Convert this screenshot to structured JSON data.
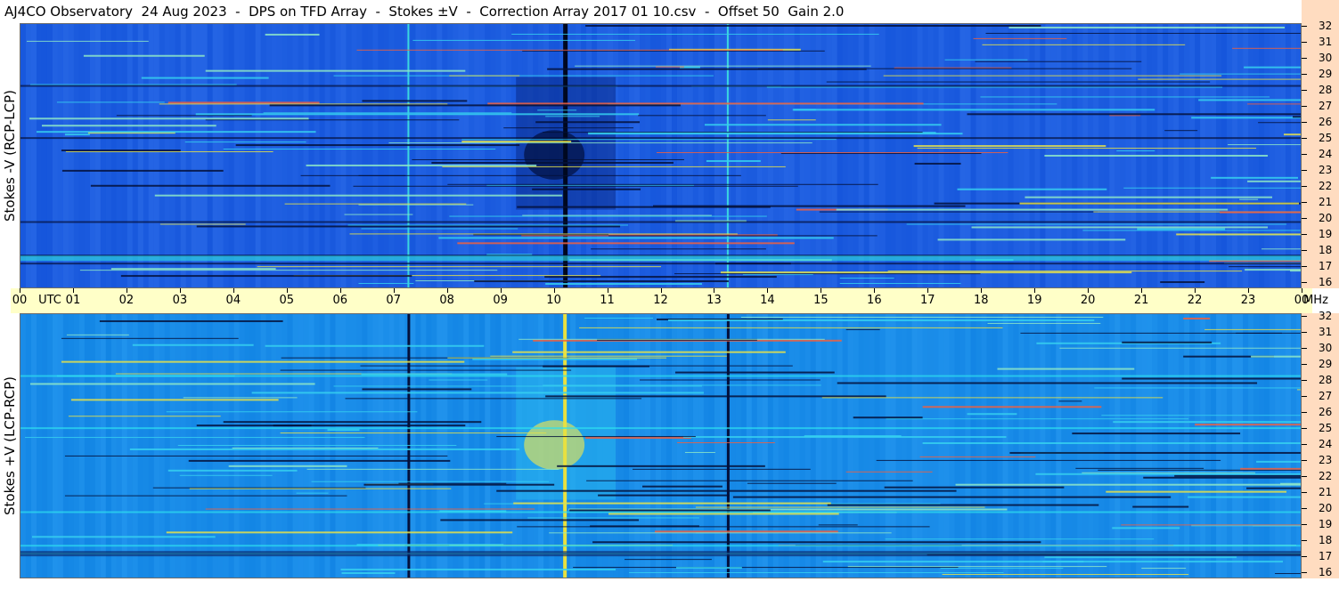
{
  "title": "AJ4CO Observatory  24 Aug 2023  -  DPS on TFD Array  -  Stokes ±V  -  Correction Array 2017 01 10.csv  -  Offset 50  Gain 2.0",
  "colors": {
    "background_top": "#1e5ee0",
    "background_bottom": "#1a8ce8",
    "time_axis_bg": "#ffffc8",
    "freq_axis_bg": "#ffdcc0",
    "dark_band": "#061650",
    "bright_band": "#e8e040"
  },
  "chart_data": {
    "type": "heatmap",
    "x_unit": "UTC",
    "y_unit": "MHz",
    "x_ticks": [
      "00",
      "01",
      "02",
      "03",
      "04",
      "05",
      "06",
      "07",
      "08",
      "09",
      "10",
      "11",
      "12",
      "13",
      "14",
      "15",
      "16",
      "17",
      "18",
      "19",
      "20",
      "21",
      "22",
      "23",
      "00"
    ],
    "xlim": [
      0,
      24
    ],
    "ylim": [
      16,
      32
    ],
    "y_ticks": [
      32,
      31,
      30,
      29,
      28,
      27,
      26,
      25,
      24,
      23,
      22,
      21,
      20,
      19,
      18,
      17,
      16
    ],
    "panels": [
      {
        "ylabel": "Stokes -V (RCP-LCP)"
      },
      {
        "ylabel": "Stokes +V (LCP-RCP)"
      }
    ]
  }
}
